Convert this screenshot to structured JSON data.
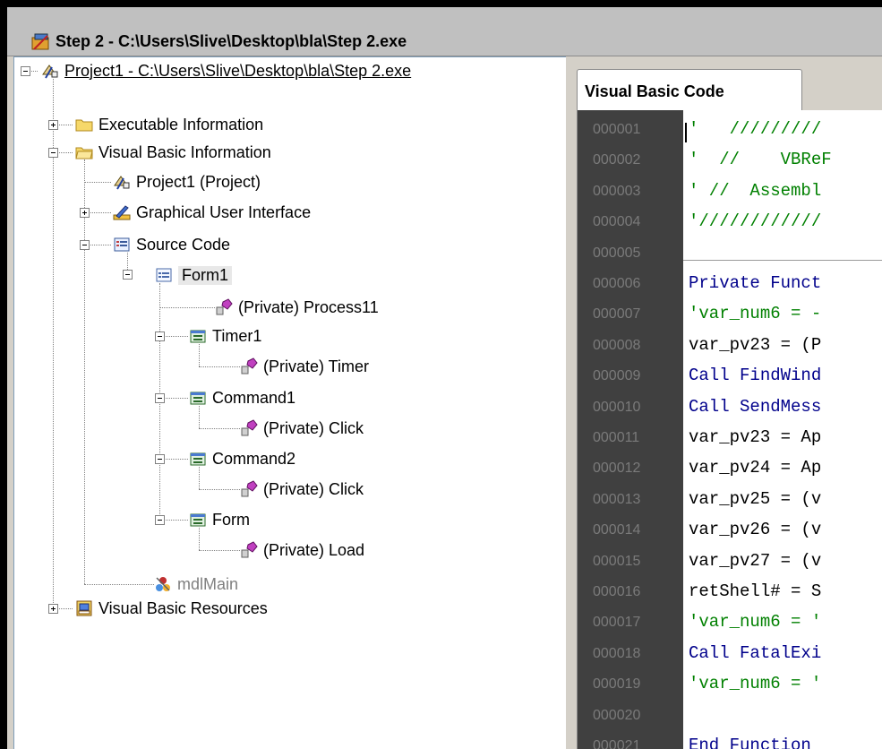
{
  "window": {
    "title": "Step 2 - C:\\Users\\Slive\\Desktop\\bla\\Step 2.exe"
  },
  "tree": {
    "root": "Project1 - C:\\Users\\Slive\\Desktop\\bla\\Step 2.exe",
    "executable_info": "Executable Information",
    "vb_info": "Visual Basic Information",
    "project": "Project1 (Project)",
    "gui": "Graphical User Interface",
    "source_code": "Source Code",
    "form1": "Form1",
    "process11": "(Private) Process11",
    "timer1": "Timer1",
    "timer": "(Private) Timer",
    "command1": "Command1",
    "click1": "(Private) Click",
    "command2": "Command2",
    "click2": "(Private) Click",
    "form": "Form",
    "load": "(Private) Load",
    "mdlmain": "mdlMain",
    "vb_resources": "Visual Basic Resources"
  },
  "tabs": {
    "vb_code": "Visual Basic Code"
  },
  "code": {
    "line_numbers": [
      "000001",
      "000002",
      "000003",
      "000004",
      "000005",
      "000006",
      "000007",
      "000008",
      "000009",
      "000010",
      "000011",
      "000012",
      "000013",
      "000014",
      "000015",
      "000016",
      "000017",
      "000018",
      "000019",
      "000020",
      "000021"
    ],
    "lines": [
      "'   /////////",
      "'  //    VBReF",
      "' //  Assembl",
      "'////////////",
      "",
      "Private Funct",
      "'var_num6 = -",
      "var_pv23 = (P",
      "Call FindWind",
      "Call SendMess",
      "var_pv23 = Ap",
      "var_pv24 = Ap",
      "var_pv25 = (v",
      "var_pv26 = (v",
      "var_pv27 = (v",
      "retShell# = S",
      "'var_num6 = '",
      "Call FatalExi",
      "'var_num6 = '",
      "",
      "End Function"
    ]
  },
  "colors": {
    "comment": "#008000",
    "keyword": "#00008b",
    "gutter": "#404040"
  }
}
